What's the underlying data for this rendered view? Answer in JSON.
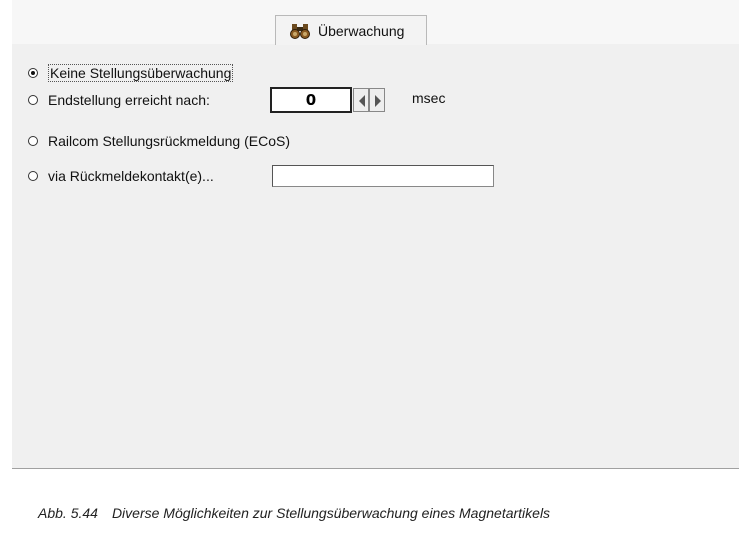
{
  "tab": {
    "icon": "binoculars-icon",
    "label": "Überwachung"
  },
  "options": [
    {
      "label": "Keine Stellungsüberwachung",
      "checked": true
    },
    {
      "label": "Endstellung erreicht nach:",
      "checked": false
    },
    {
      "label": "Railcom Stellungsrückmeldung (ECoS)",
      "checked": false
    },
    {
      "label": "via Rückmeldekontakt(e)...",
      "checked": false
    }
  ],
  "delay": {
    "value": "0",
    "unit": "msec"
  },
  "feedback_contacts": {
    "value": ""
  },
  "caption": {
    "number": "Abb. 5.44",
    "text": "Diverse Möglichkeiten zur Stellungsüberwachung eines Magnetartikels"
  }
}
